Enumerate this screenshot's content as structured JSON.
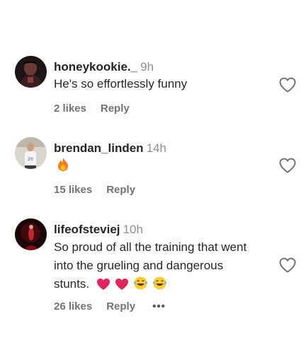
{
  "comments": [
    {
      "username": "honeykookie._",
      "time": "9h",
      "text": "He's so effortlessly funny",
      "likes": "2 likes",
      "reply": "Reply"
    },
    {
      "username": "brendan_linden",
      "time": "14h",
      "text": "",
      "emoji": [
        "fire-emoji"
      ],
      "likes": "15 likes",
      "reply": "Reply"
    },
    {
      "username": "lifeofsteviej",
      "time": "10h",
      "text": "So proud of all the training that went into the grueling and dangerous stunts.",
      "emoji": [
        "red-heart-emoji",
        "red-heart-emoji",
        "tears-of-joy-emoji",
        "tears-of-joy-emoji"
      ],
      "likes": "26 likes",
      "reply": "Reply",
      "more": "•••"
    }
  ],
  "icons": {
    "like": "heart-outline-icon",
    "more": "more-options-icon"
  },
  "colors": {
    "text": "#262626",
    "secondary": "#737373",
    "timestamp": "#8e8e8e",
    "heart_emoji": "#e0245e",
    "fire_emoji": "#ff7a1a"
  }
}
